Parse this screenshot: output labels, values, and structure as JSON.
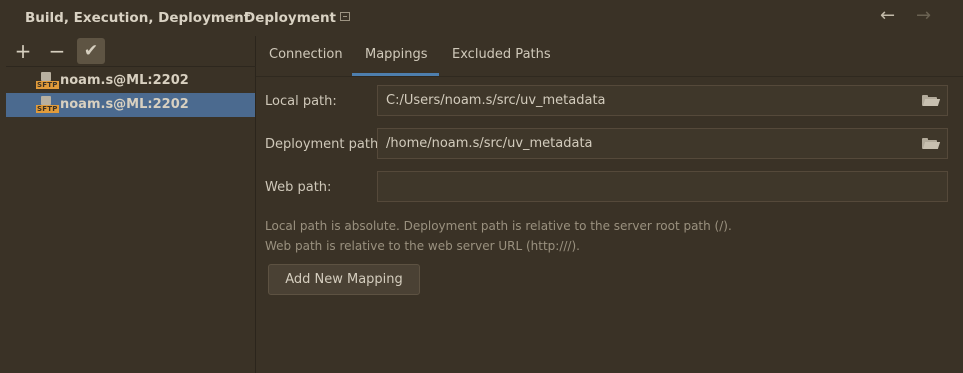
{
  "breadcrumb": {
    "parent": "Build, Execution, Deployment",
    "separator": "›",
    "current": "Deployment"
  },
  "nav": {
    "back_icon": "←",
    "forward_icon": "→"
  },
  "toolbar": {
    "add_icon": "+",
    "remove_icon": "−",
    "apply_icon": "✔"
  },
  "servers": [
    {
      "label": "noam.s@ML:2202",
      "icon_tag": "SFTP",
      "selected": false
    },
    {
      "label": "noam.s@ML:2202",
      "icon_tag": "SFTP",
      "selected": true
    }
  ],
  "tabs": [
    {
      "label": "Connection",
      "active": false
    },
    {
      "label": "Mappings",
      "active": true
    },
    {
      "label": "Excluded Paths",
      "active": false
    }
  ],
  "fields": {
    "local_path": {
      "label": "Local path:",
      "value": "C:/Users/noam.s/src/uv_metadata"
    },
    "deployment_path": {
      "label": "Deployment path:",
      "value": "/home/noam.s/src/uv_metadata"
    },
    "web_path": {
      "label": "Web path:",
      "value": ""
    }
  },
  "hints": [
    "Local path is absolute. Deployment path is relative to the server root path (/).",
    "Web path is relative to the web server URL (http:///)."
  ],
  "add_mapping_label": "Add New Mapping",
  "colors": {
    "background": "#3a3226",
    "selection": "#4b6a8f",
    "tab_underline": "#4e7fae",
    "sftp_tag": "#e19b3a"
  }
}
